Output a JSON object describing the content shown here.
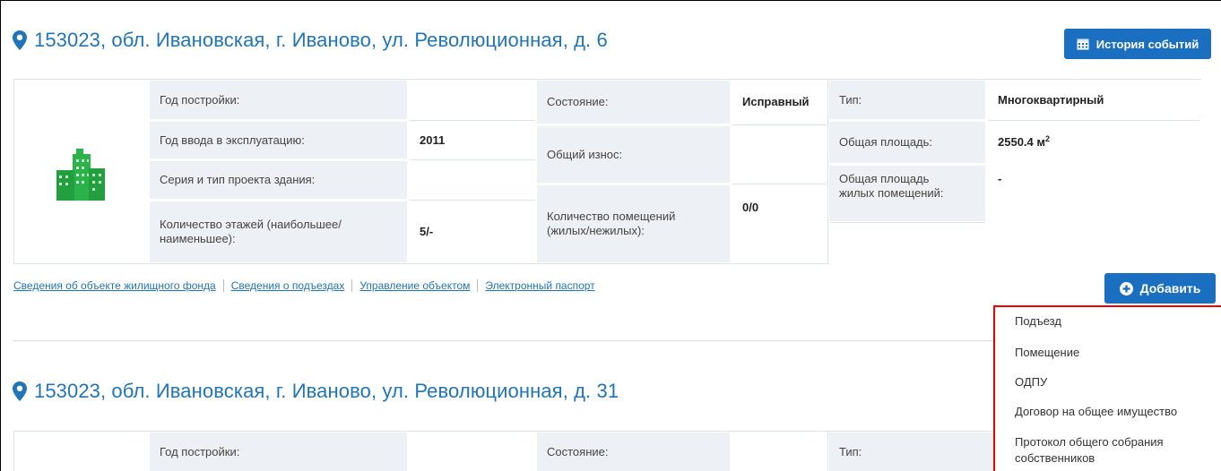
{
  "building1": {
    "address": "153023, обл. Ивановская, г. Иваново, ул. Революционная, д. 6",
    "history_button": "История событий",
    "year_built_label": "Год постройки:",
    "year_built_value": "",
    "year_commissioned_label": "Год ввода в эксплуатацию:",
    "year_commissioned_value": "2011",
    "series_label": "Серия и тип проекта здания:",
    "series_value": "",
    "floors_label": "Количество этажей (наибольшее/ наименьшее):",
    "floors_value": "5/-",
    "state_label": "Состояние:",
    "state_value": "Исправный",
    "wear_label": "Общий износ:",
    "wear_value": "",
    "rooms_label": "Количество помещений (жилых/нежилых):",
    "rooms_value": "0/0",
    "type_label": "Тип:",
    "type_value": "Многоквартирный",
    "area_label": "Общая площадь:",
    "area_value": "2550.4 м",
    "area_unit_sup": "2",
    "living_area_label": "Общая площадь жилых помещений:",
    "living_area_value": "-"
  },
  "links": [
    "Сведения об объекте жилищного фонда",
    "Сведения о подъездах",
    "Управление объектом",
    "Электронный паспорт"
  ],
  "add_button": "Добавить",
  "add_menu": [
    "Подъезд",
    "Помещение",
    "ОДПУ",
    "Договор на общее имущество",
    "Протокол общего собрания собственников"
  ],
  "building2": {
    "address": "153023, обл. Ивановская, г. Иваново, ул. Революционная, д. 31",
    "year_built_label": "Год постройки:",
    "state_label": "Состояние:",
    "type_label": "Тип:"
  },
  "colors": {
    "accent": "#1a6fc0",
    "link": "#1f75b8",
    "building_icon": "#2bb34a",
    "menu_border": "#ee0000",
    "gray_cell": "#edf0f4"
  }
}
